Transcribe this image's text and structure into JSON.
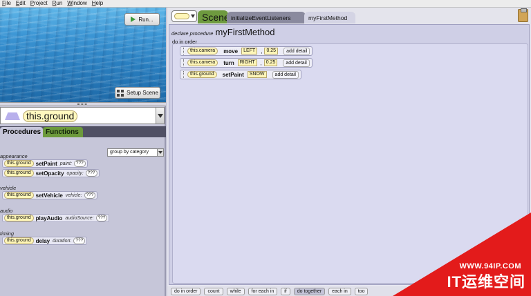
{
  "menu": [
    "File",
    "Edit",
    "Project",
    "Run",
    "Window",
    "Help"
  ],
  "scene_view": {
    "run_label": "Run...",
    "setup_scene_label": "Setup Scene"
  },
  "instance": {
    "name": "this.ground"
  },
  "left_tabs": {
    "procedures": "Procedures",
    "functions": "Functions"
  },
  "group_by": "group by category",
  "categories": [
    {
      "label": "appearance",
      "items": [
        {
          "target": "this.ground",
          "method": "setPaint",
          "param": "paint:",
          "value": "???"
        },
        {
          "target": "this.ground",
          "method": "setOpacity",
          "param": "opacity:",
          "value": "???"
        }
      ]
    },
    {
      "label": "vehicle",
      "items": [
        {
          "target": "this.ground",
          "method": "setVehicle",
          "param": "vehicle:",
          "value": "???"
        }
      ]
    },
    {
      "label": "audio",
      "items": [
        {
          "target": "this.ground",
          "method": "playAudio",
          "param": "audioSource:",
          "value": "???"
        }
      ]
    },
    {
      "label": "timing",
      "items": [
        {
          "target": "this.ground",
          "method": "delay",
          "param": "duration:",
          "value": "???"
        }
      ]
    }
  ],
  "editor_tabs": {
    "scene": "Scene",
    "init": "initializeEventListeners",
    "method": "myFirstMethod"
  },
  "method_decl": {
    "keyword": "declare procedure",
    "name": "myFirstMethod"
  },
  "do_in_order": "do in order",
  "statements": [
    {
      "target": "this.camera",
      "method": "move",
      "args": [
        "LEFT",
        "0.25"
      ],
      "detail": "add detail"
    },
    {
      "target": "this.camera",
      "method": "turn",
      "args": [
        "RIGHT",
        "0.25"
      ],
      "detail": "add detail"
    },
    {
      "target": "this.ground",
      "method": "setPaint",
      "args": [
        "SNOW"
      ],
      "detail": "add detail"
    }
  ],
  "palette": [
    "do in order",
    "count",
    "while",
    "for each in",
    "if",
    "do together",
    "each in",
    "too"
  ],
  "watermark": {
    "url": "WWW.94IP.COM",
    "brand": "IT运维空间"
  }
}
